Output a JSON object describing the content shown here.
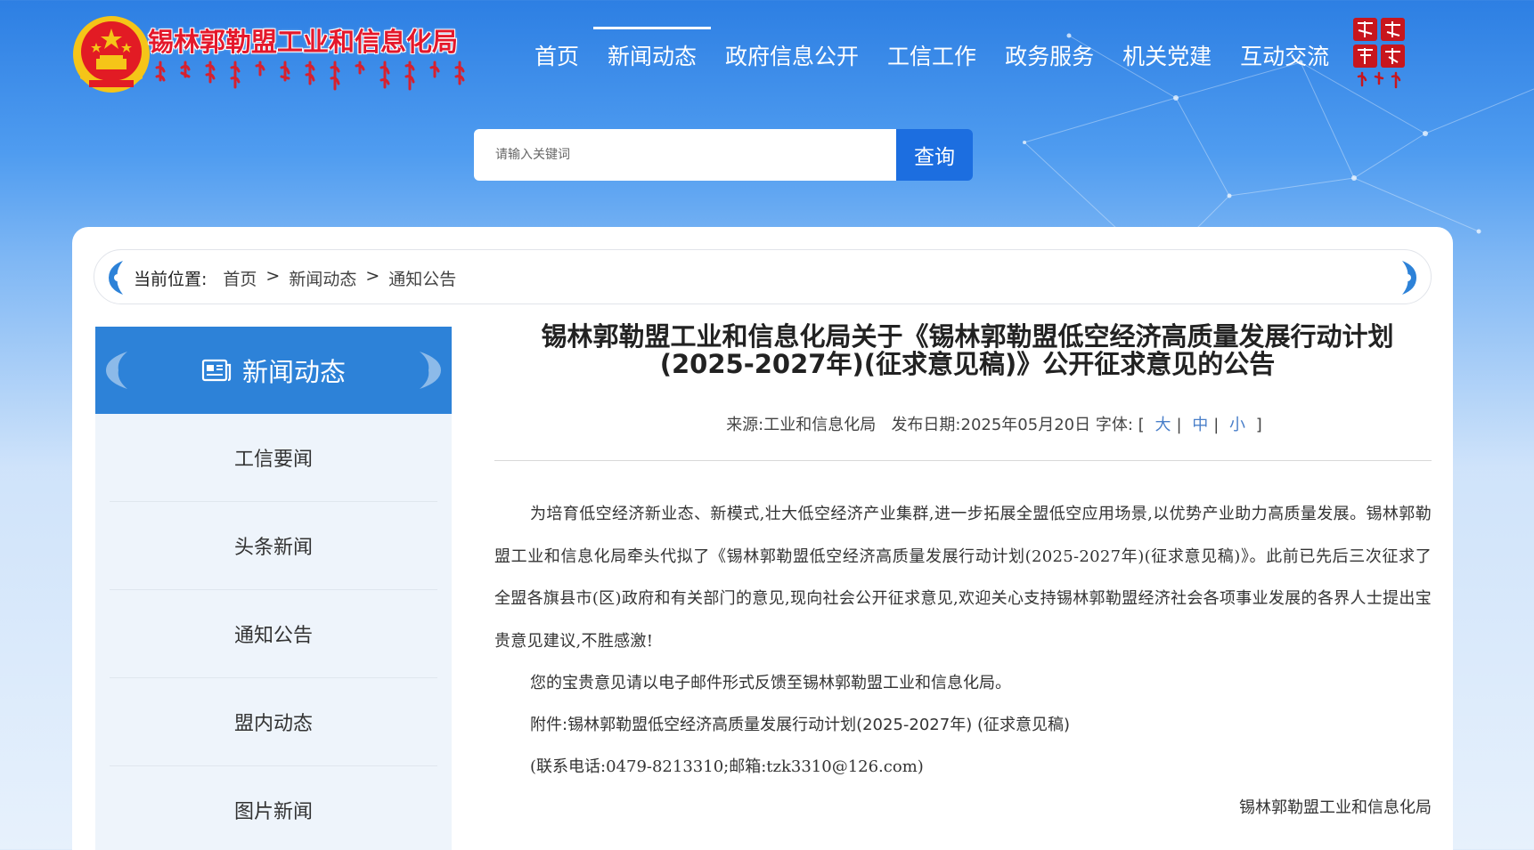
{
  "header": {
    "site_title": "锡林郭勒盟工业和信息化局",
    "nav": [
      {
        "label": "首页",
        "active": false
      },
      {
        "label": "新闻动态",
        "active": true
      },
      {
        "label": "政府信息公开",
        "active": false
      },
      {
        "label": "工信工作",
        "active": false
      },
      {
        "label": "政务服务",
        "active": false
      },
      {
        "label": "机关党建",
        "active": false
      },
      {
        "label": "互动交流",
        "active": false
      }
    ]
  },
  "search": {
    "placeholder": "请输入关键词",
    "button_label": "查询"
  },
  "breadcrumb": {
    "label": "当前位置:",
    "items": [
      "首页",
      "新闻动态",
      "通知公告"
    ],
    "separator": ">"
  },
  "sidebar": {
    "title": "新闻动态",
    "items": [
      "工信要闻",
      "头条新闻",
      "通知公告",
      "盟内动态",
      "图片新闻"
    ]
  },
  "article": {
    "title_line1": "锡林郭勒盟工业和信息化局关于《锡林郭勒盟低空经济高质量发展行动计划",
    "title_line2": "(2025-2027年)(征求意见稿)》公开征求意见的公告",
    "meta_source": "来源:工业和信息化局",
    "meta_date": "发布日期:2025年05月20日",
    "meta_font_label": "字体:",
    "font_sizes": [
      "大",
      "中",
      "小"
    ],
    "paragraph1": "为培育低空经济新业态、新模式,壮大低空经济产业集群,进一步拓展全盟低空应用场景,以优势产业助力高质量发展。锡林郭勒盟工业和信息化局牵头代拟了《锡林郭勒盟低空经济高质量发展行动计划(2025-2027年)(征求意见稿)》。此前已先后三次征求了全盟各旗县市(区)政府和有关部门的意见,现向社会公开征求意见,欢迎关心支持锡林郭勒盟经济社会各项事业发展的各界人士提出宝贵意见建议,不胜感激!",
    "paragraph2": "您的宝贵意见请以电子邮件形式反馈至锡林郭勒盟工业和信息化局。",
    "attachment_label": "附件:",
    "attachment_name": "锡林郭勒盟低空经济高质量发展行动计划(2025-2027年) (征求意见稿)",
    "contact": "(联系电话:0479-8213310;邮箱:tzk3310@126.com)",
    "signature": "锡林郭勒盟工业和信息化局"
  },
  "colors": {
    "brand_red": "#e4182b",
    "nav_blue": "#2d82d8",
    "search_button": "#1c6ee0"
  }
}
